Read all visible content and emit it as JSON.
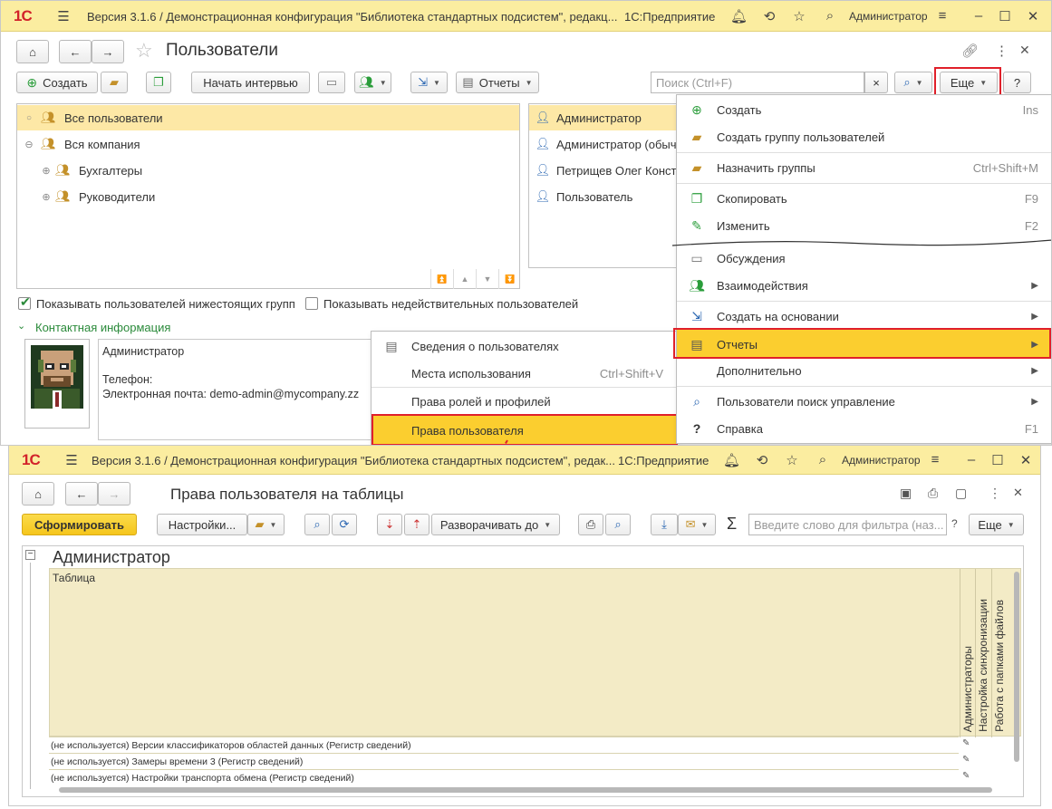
{
  "window1": {
    "title": "Версия 3.1.6 / Демонстрационная конфигурация \"Библиотека стандартных подсистем\", редакц...",
    "app_name": "1С:Предприятие",
    "user": "Администратор",
    "form_title": "Пользователи",
    "toolbar": {
      "create_label": "Создать",
      "interview_label": "Начать интервью",
      "reports_label": "Отчеты",
      "search_placeholder": "Поиск (Ctrl+F)",
      "search_clear": "×",
      "more_label": "Еще",
      "help_label": "?"
    },
    "groups_tree": [
      {
        "label": "Все пользователи",
        "toggle": "○"
      },
      {
        "label": "Вся компания",
        "toggle": "⊖"
      },
      {
        "label": "Бухгалтеры",
        "toggle": "⊕"
      },
      {
        "label": "Руководители",
        "toggle": "⊕"
      }
    ],
    "users_list": [
      "Администратор",
      "Администратор (обыч",
      "Петрищев Олег Конст",
      "Пользователь"
    ],
    "show_subgroup_users_label": "Показывать пользователей нижестоящих групп",
    "show_subgroup_users_checked": true,
    "show_invalid_users_label": "Показывать недействительных пользователей",
    "show_invalid_users_checked": false,
    "contact_section_label": "Контактная информация",
    "contact": {
      "name": "Администратор",
      "phone_label": "Телефон:",
      "email_line": "Электронная почта: demo-admin@mycompany.zz"
    },
    "more_menu": [
      {
        "label": "Создать",
        "shortcut": "Ins",
        "icon": "plus-circle-icon"
      },
      {
        "label": "Создать группу пользователей",
        "shortcut": "",
        "icon": "add-folder-icon"
      },
      {
        "label": "Назначить группы",
        "shortcut": "Ctrl+Shift+M",
        "icon": "assign-groups-icon"
      },
      {
        "label": "Скопировать",
        "shortcut": "F9",
        "icon": "copy-icon"
      },
      {
        "label": "Изменить",
        "shortcut": "F2",
        "icon": "pencil-icon"
      },
      {
        "label": "Обсуждения",
        "shortcut": "",
        "icon": "chat-icon"
      },
      {
        "label": "Взаимодействия",
        "shortcut": "",
        "icon": "interactions-icon"
      },
      {
        "label": "Создать на основании",
        "shortcut": "",
        "icon": "create-based-on-icon"
      },
      {
        "label": "Отчеты",
        "shortcut": "",
        "icon": "report-icon"
      },
      {
        "label": "Дополнительно",
        "shortcut": "",
        "icon": ""
      },
      {
        "label": "Пользователи поиск управление",
        "shortcut": "",
        "icon": "search-icon"
      },
      {
        "label": "Справка",
        "shortcut": "F1",
        "icon": "question-icon"
      }
    ],
    "reports_submenu": [
      {
        "label": "Сведения о пользователях",
        "shortcut": ""
      },
      {
        "label": "Места использования",
        "shortcut": "Ctrl+Shift+V"
      },
      {
        "label": "Права ролей и профилей",
        "shortcut": ""
      },
      {
        "label": "Права пользователя",
        "shortcut": ""
      }
    ]
  },
  "window2": {
    "title": "Версия 3.1.6 / Демонстрационная конфигурация \"Библиотека стандартных подсистем\", редак...",
    "app_name": "1С:Предприятие",
    "user": "Администратор",
    "form_title": "Права пользователя на таблицы",
    "toolbar": {
      "generate_label": "Сформировать",
      "settings_label": "Настройки...",
      "expand_label": "Разворачивать до",
      "filter_placeholder": "Введите слово для фильтра (наз...",
      "help_label": "?",
      "more_label": "Еще",
      "sigma": "Σ"
    },
    "report": {
      "header": "Администратор",
      "table_column_label": "Таблица",
      "column_headers": [
        "Администраторы",
        "Настройка синхронизации",
        "Работа с папками файлов"
      ],
      "rows": [
        "(не используется) Версии классификаторов областей данных (Регистр сведений)",
        "(не используется) Замеры времени 3 (Регистр сведений)",
        "(не используется) Настройки транспорта обмена (Регистр сведений)"
      ]
    }
  },
  "colors": {
    "titlebar": "#fbeda0",
    "highlight": "#fbce2f",
    "selected_row": "#fde8a6",
    "callout": "#e0202a",
    "primary_button": "#f9d12c",
    "report_bg": "#f3ebc6"
  }
}
